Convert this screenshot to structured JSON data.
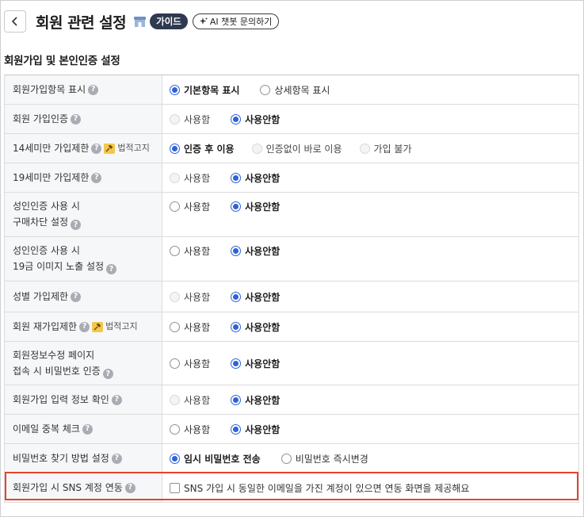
{
  "header": {
    "title": "회원 관련 설정",
    "guide_label": "가이드",
    "ai_label": "AI 챗봇 문의하기"
  },
  "section": {
    "title": "회원가입 및 본인인증 설정"
  },
  "law_label": "법적고지",
  "rows": [
    {
      "label": "회원가입항목 표시",
      "options": [
        "기본항목 표시",
        "상세항목 표시"
      ],
      "selected": 0
    },
    {
      "label": "회원 가입인증",
      "options": [
        "사용함",
        "사용안함"
      ],
      "selected": 1
    },
    {
      "label": "14세미만 가입제한",
      "options": [
        "인증 후 이용",
        "인증없이 바로 이용",
        "가입 불가"
      ],
      "selected": 0
    },
    {
      "label": "19세미만 가입제한",
      "options": [
        "사용함",
        "사용안함"
      ],
      "selected": 1
    },
    {
      "label_line1": "성인인증 사용 시",
      "label_line2": "구매차단 설정",
      "options": [
        "사용함",
        "사용안함"
      ],
      "selected": 1
    },
    {
      "label_line1": "성인인증 사용 시",
      "label_line2": "19금 이미지 노출 설정",
      "options": [
        "사용함",
        "사용안함"
      ],
      "selected": 1
    },
    {
      "label": "성별 가입제한",
      "options": [
        "사용함",
        "사용안함"
      ],
      "selected": 1
    },
    {
      "label": "회원 재가입제한",
      "options": [
        "사용함",
        "사용안함"
      ],
      "selected": 1
    },
    {
      "label_line1": "회원정보수정 페이지",
      "label_line2": "접속 시 비밀번호 인증",
      "options": [
        "사용함",
        "사용안함"
      ],
      "selected": 1
    },
    {
      "label": "회원가입 입력 정보 확인",
      "options": [
        "사용함",
        "사용안함"
      ],
      "selected": 1
    },
    {
      "label": "이메일 중복 체크",
      "options": [
        "사용함",
        "사용안함"
      ],
      "selected": 1
    },
    {
      "label": "비밀번호 찾기 방법 설정",
      "options": [
        "임시 비밀번호 전송",
        "비밀번호 즉시변경"
      ],
      "selected": 0
    },
    {
      "label": "회원가입 시 SNS 계정 연동",
      "checkbox_label": "SNS 가입 시 동일한 이메일을 가진 계정이 있으면 연동 화면을 제공해요",
      "checked": false
    }
  ]
}
